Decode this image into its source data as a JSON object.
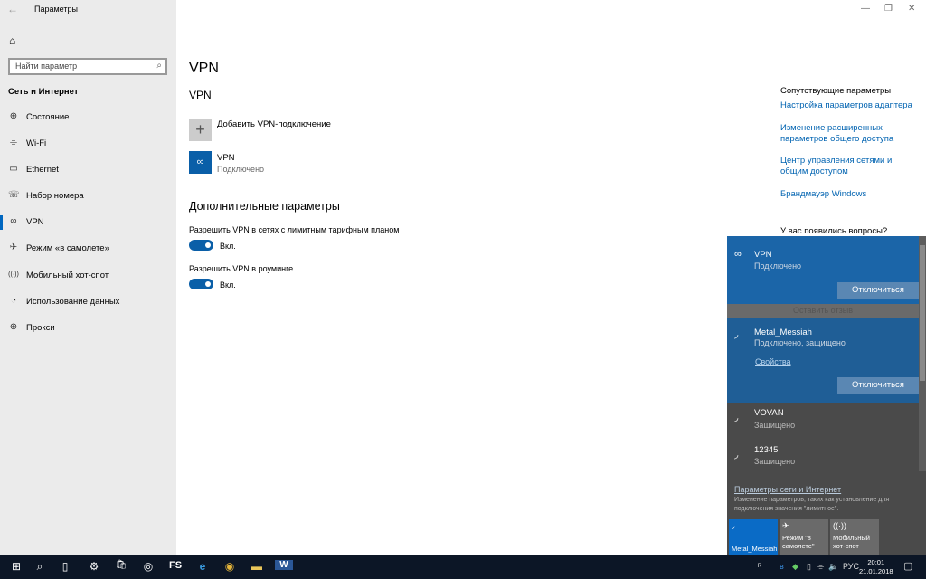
{
  "window": {
    "title": "Параметры",
    "back_icon": "←",
    "minimize": "—",
    "maximize": "❐",
    "close": "✕"
  },
  "sidebar": {
    "home_icon": "⌂",
    "search_placeholder": "Найти параметр",
    "search_icon": "⌕",
    "section": "Сеть и Интернет",
    "items": [
      {
        "label": "Состояние",
        "icon": "⊕",
        "selected": false
      },
      {
        "label": "Wi-Fi",
        "icon": "⌯",
        "selected": false
      },
      {
        "label": "Ethernet",
        "icon": "▭",
        "selected": false
      },
      {
        "label": "Набор номера",
        "icon": "☏",
        "selected": false
      },
      {
        "label": "VPN",
        "icon": "∞",
        "selected": true
      },
      {
        "label": "Режим «в самолете»",
        "icon": "✈",
        "selected": false
      },
      {
        "label": "Мобильный хот-спот",
        "icon": "((·))",
        "selected": false
      },
      {
        "label": "Использование данных",
        "icon": "◔",
        "selected": false
      },
      {
        "label": "Прокси",
        "icon": "⊕",
        "selected": false
      }
    ]
  },
  "main": {
    "title": "VPN",
    "subtitle": "VPN",
    "add": {
      "icon": "+",
      "label": "Добавить VPN-подключение"
    },
    "connection": {
      "icon": "∞",
      "name": "VPN",
      "status": "Подключено"
    },
    "advanced_title": "Дополнительные параметры",
    "options": [
      {
        "label": "Разрешить VPN в сетях с лимитным тарифным планом",
        "state": "Вкл.",
        "on": true
      },
      {
        "label": "Разрешить VPN в роуминге",
        "state": "Вкл.",
        "on": true
      }
    ]
  },
  "related": {
    "title": "Сопутствующие параметры",
    "links": [
      "Настройка параметров адаптера",
      "Изменение расширенных параметров общего доступа",
      "Центр управления сетями и общим доступом",
      "Брандмауэр Windows"
    ],
    "question": "У вас появились вопросы?",
    "feedback": "Оставить отзыв"
  },
  "flyout": {
    "vpn": {
      "name": "VPN",
      "status": "Подключено",
      "button": "Отключиться"
    },
    "wifi": {
      "name": "Metal_Messiah",
      "status": "Подключено, защищено",
      "properties": "Свойства",
      "button": "Отключиться"
    },
    "networks": [
      {
        "name": "VOVAN",
        "status": "Защищено"
      },
      {
        "name": "12345",
        "status": "Защищено"
      }
    ],
    "settings_link": "Параметры сети и Интернет",
    "description": "Изменение параметров, таких как установление для подключения значения \"лимитное\".",
    "quick_actions": [
      {
        "label": "Metal_Messiah",
        "icon": "◞",
        "on": true
      },
      {
        "label": "Режим \"в самолете\"",
        "icon": "✈",
        "on": false
      },
      {
        "label": "Мобильный хот-спот",
        "icon": "((·))",
        "on": false
      }
    ]
  },
  "taskbar": {
    "apps": [
      "⊞",
      "⌕",
      "▯",
      "⚙",
      "🛍",
      "◎",
      "FS",
      "e",
      "◉",
      "▬",
      "W"
    ],
    "tray": [
      "ᴿ",
      "ʙ",
      "◆",
      "▯",
      "⌯",
      "🔈"
    ],
    "lang": "РУС",
    "time": "20:01",
    "date": "21.01.2018",
    "notif": "▢"
  }
}
